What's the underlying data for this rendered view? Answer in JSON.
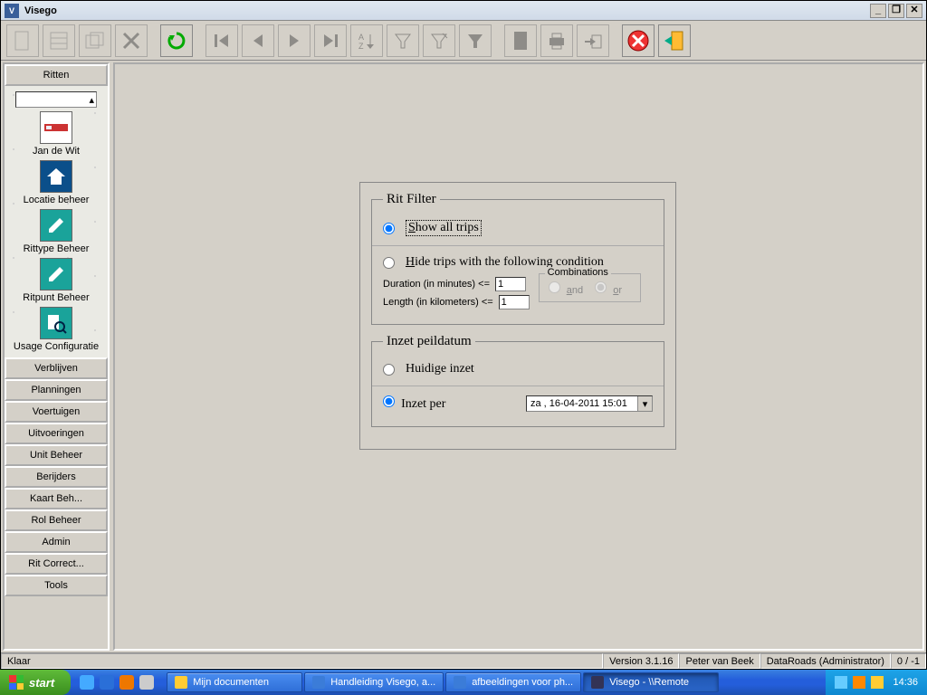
{
  "window": {
    "title": "Visego",
    "min": "_",
    "max": "❐",
    "close": "✕"
  },
  "status": {
    "ready": "Klaar",
    "version": "Version 3.1.16",
    "user": "Peter van Beek",
    "role": "DataRoads (Administrator)",
    "counter": "0 / -1"
  },
  "sidebar": {
    "header": "Ritten",
    "icons": [
      {
        "label": "Jan de Wit"
      },
      {
        "label": "Locatie beheer"
      },
      {
        "label": "Rittype Beheer"
      },
      {
        "label": "Ritpunt Beheer"
      },
      {
        "label": "Usage Configuratie"
      }
    ],
    "buttons": [
      "Verblijven",
      "Planningen",
      "Voertuigen",
      "Uitvoeringen",
      "Unit Beheer",
      "Berijders",
      "Kaart Beh...",
      "Rol Beheer",
      "Admin",
      "Rit Correct...",
      "Tools"
    ]
  },
  "filter": {
    "legend": "Rit Filter",
    "show_all_prefix": "S",
    "show_all_rest": "how all trips",
    "hide_prefix": "H",
    "hide_rest": "ide trips with the following condition",
    "duration_label": "Duration (in minutes) <=",
    "duration_value": "1",
    "length_label": "Length (in kilometers) <=",
    "length_value": "1",
    "combi_legend": "Combinations",
    "combi_and_prefix": "a",
    "combi_and_rest": "nd",
    "combi_or_prefix": "o",
    "combi_or_rest": "r"
  },
  "peildatum": {
    "legend": "Inzet peildatum",
    "huidige": "Huidige inzet",
    "inzet_per": "Inzet per",
    "date_value": "za , 16-04-2011 15:01"
  },
  "taskbar": {
    "start": "start",
    "tasks": [
      {
        "label": "Mijn documenten"
      },
      {
        "label": "Handleiding Visego, a..."
      },
      {
        "label": "afbeeldingen voor ph..."
      },
      {
        "label": "Visego - \\\\Remote"
      }
    ],
    "clock": "14:36"
  }
}
